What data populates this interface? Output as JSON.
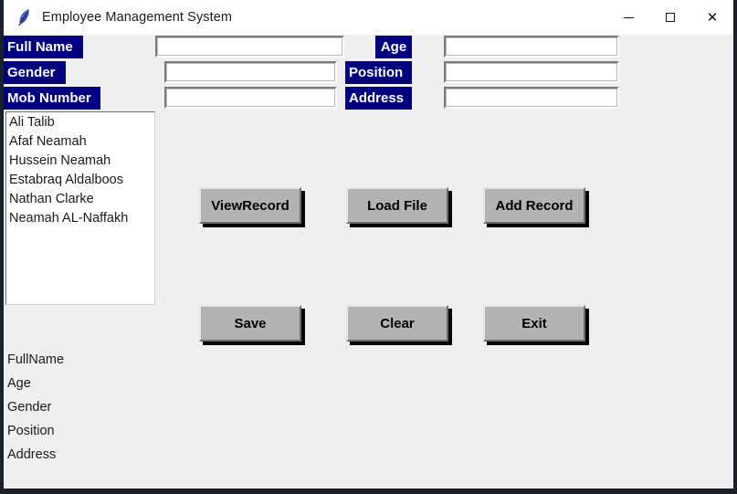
{
  "window": {
    "title": "Employee Management System",
    "icon": "feather-icon",
    "controls": {
      "minimize": "minimize-icon",
      "maximize": "maximize-icon",
      "close": "close-icon"
    }
  },
  "colors": {
    "label_bg": "#000080",
    "label_fg": "#ffffff",
    "client_bg": "#efefef",
    "button_bg": "#b3b3b3",
    "titlebar_bg": "#ffffff",
    "frame": "#1b212b"
  },
  "form": {
    "fields": [
      {
        "label": "Full Name",
        "value": "",
        "placeholder": ""
      },
      {
        "label": "Gender",
        "value": "",
        "placeholder": ""
      },
      {
        "label": "Mob Number",
        "value": "",
        "placeholder": ""
      },
      {
        "label": "Age",
        "value": "",
        "placeholder": ""
      },
      {
        "label": "Position",
        "value": "",
        "placeholder": ""
      },
      {
        "label": "Address",
        "value": "",
        "placeholder": ""
      }
    ]
  },
  "employee_list": {
    "items": [
      "Ali Talib",
      "Afaf Neamah",
      "Hussein Neamah",
      "Estabraq Aldalboos",
      "Nathan Clarke",
      "Neamah AL-Naffakh"
    ]
  },
  "buttons": {
    "row1": [
      {
        "label": "ViewRecord"
      },
      {
        "label": "Load File"
      },
      {
        "label": "Add Record"
      }
    ],
    "row2": [
      {
        "label": "Save"
      },
      {
        "label": "Clear"
      },
      {
        "label": "Exit"
      }
    ]
  },
  "detail_labels": [
    "FullName",
    "Age",
    "Gender",
    "Position",
    "Address"
  ]
}
